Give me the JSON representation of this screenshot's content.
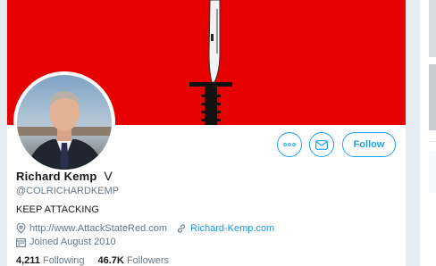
{
  "colors": {
    "accent": "#1da1f2",
    "link": "#1b95e0",
    "banner": "#e60000",
    "muted": "#657786"
  },
  "profile": {
    "name_first": "Richard",
    "name_last": "Kemp",
    "verified_glyph": "V",
    "handle": "@COLRICHARDKEMP",
    "bio": "KEEP ATTACKING",
    "website_text": "http://www.AttackStateRed.com",
    "link2_text": "Richard-Kemp.com",
    "joined": "Joined August 2010"
  },
  "actions": {
    "more_icon": "more-icon",
    "message_icon": "envelope-icon",
    "follow_label": "Follow"
  },
  "stats": {
    "following_count": "4,211",
    "following_label": "Following",
    "followers_count": "46.7K",
    "followers_label": "Followers"
  }
}
